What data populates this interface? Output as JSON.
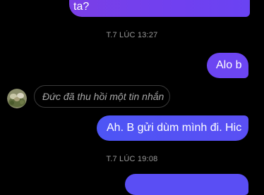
{
  "messages": {
    "partial_top": "ta?",
    "alo": "Alo b",
    "recalled": "Đức đã thu hồi một tin nhắn",
    "ah": "Ah. B gửi dùm mình đi. Hic"
  },
  "timestamps": {
    "first": "T.7 LÚC 13:27",
    "second": "T.7 LÚC 19:08"
  },
  "colors": {
    "background": "#000000",
    "outgoing_purple": "#6c45f2",
    "outgoing_blue": "#4d55f5",
    "timestamp_gray": "#9a9a9a",
    "recalled_border": "#3a3a3a"
  },
  "icons": {
    "avatar": "contact-avatar-photo"
  }
}
